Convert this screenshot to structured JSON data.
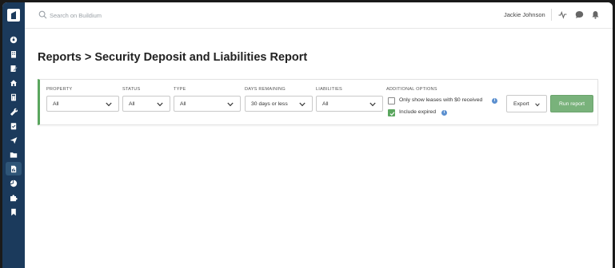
{
  "topbar": {
    "search_placeholder": "Search on Buildium",
    "user_name": "Jackie Johnson",
    "icons": [
      "activity-icon",
      "chat-icon",
      "bell-icon"
    ]
  },
  "sidebar": {
    "items": [
      {
        "icon": "dashboard-icon"
      },
      {
        "icon": "building-icon"
      },
      {
        "icon": "lease-icon"
      },
      {
        "icon": "home-icon"
      },
      {
        "icon": "accounting-icon"
      },
      {
        "icon": "wrench-icon"
      },
      {
        "icon": "tasks-icon"
      },
      {
        "icon": "send-icon"
      },
      {
        "icon": "folder-icon"
      },
      {
        "icon": "reports-icon",
        "active": true
      },
      {
        "icon": "analytics-icon"
      },
      {
        "icon": "puzzle-icon"
      },
      {
        "icon": "bookmark-icon"
      }
    ]
  },
  "page": {
    "title_bold": "Reports",
    "title_rest": " > Security Deposit and Liabilities Report"
  },
  "filters": {
    "property": {
      "label": "PROPERTY",
      "value": "All"
    },
    "status": {
      "label": "STATUS",
      "value": "All"
    },
    "type": {
      "label": "TYPE",
      "value": "All"
    },
    "days_remaining": {
      "label": "DAYS REMAINING",
      "value": "30 days or less"
    },
    "liabilities": {
      "label": "LIABILITIES",
      "value": "All"
    }
  },
  "options": {
    "label": "ADDITIONAL OPTIONS",
    "only_zero_received": {
      "label": "Only show leases with $0 received",
      "checked": false
    },
    "include_expired": {
      "label": "Include expired",
      "checked": true
    }
  },
  "actions": {
    "export_label": "Export",
    "run_label": "Run report"
  },
  "colors": {
    "sidebar": "#1b3a5c",
    "accent_green": "#5aa65e",
    "run_button": "#79b27b",
    "info_blue": "#5b8fcf"
  }
}
